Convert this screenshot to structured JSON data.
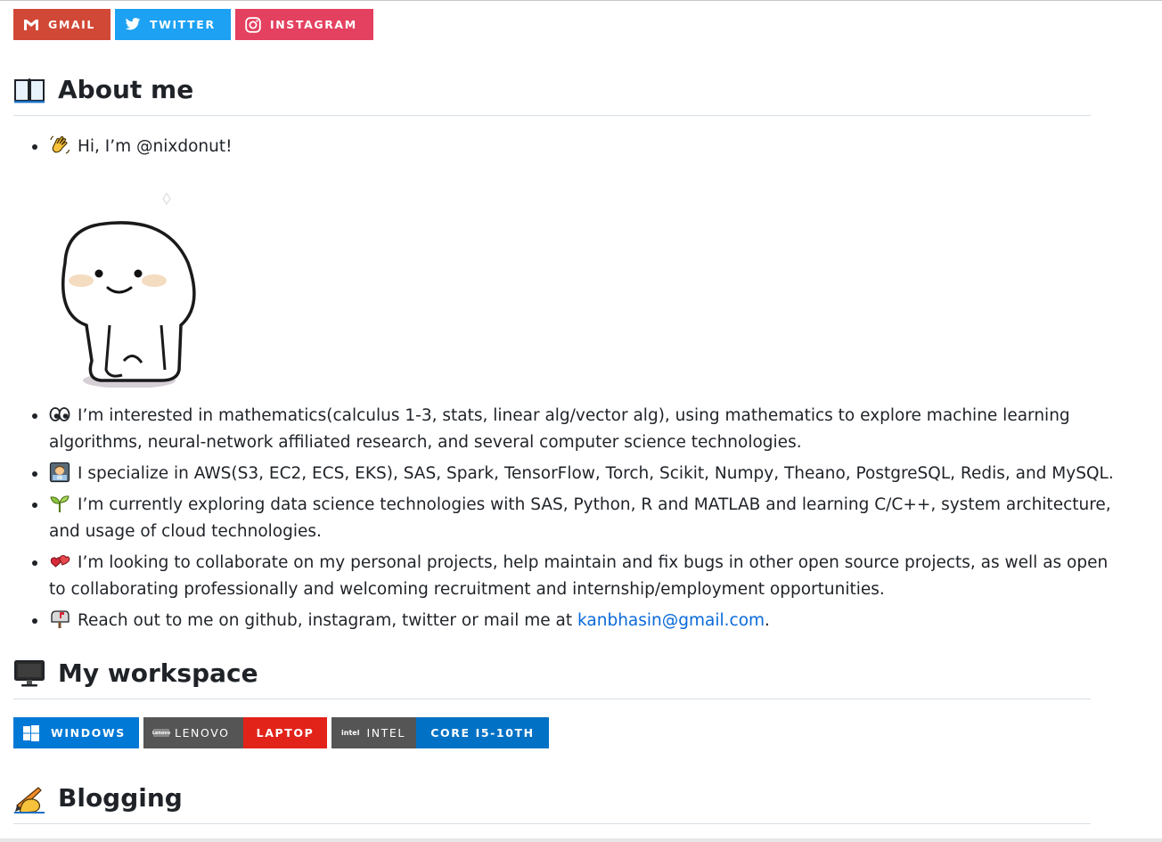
{
  "social_badges": [
    {
      "label": "GMAIL",
      "icon": "gmail-icon",
      "color": "#d14836"
    },
    {
      "label": "TWITTER",
      "icon": "twitter-icon",
      "color": "#1da1f2"
    },
    {
      "label": "INSTAGRAM",
      "icon": "instagram-icon",
      "color": "#e4405f"
    }
  ],
  "about": {
    "heading": "About me",
    "heading_icon": "open-book-icon",
    "greeting": "Hi, I’m @nixdonut!",
    "items": [
      {
        "icon": "eyes-icon",
        "text": "I’m interested in mathematics(calculus 1-3, stats, linear alg/vector alg), using mathematics to explore machine learning algorithms, neural-network affiliated research, and several computer science technologies."
      },
      {
        "icon": "technologist-icon",
        "text": "I specialize in AWS(S3, EC2, ECS, EKS), SAS, Spark, TensorFlow, Torch, Scikit, Numpy, Theano, PostgreSQL, Redis, and MySQL."
      },
      {
        "icon": "seedling-icon",
        "text": "I’m currently exploring data science technologies with SAS, Python, R and MATLAB and learning C/C++, system architecture, and usage of cloud technologies."
      },
      {
        "icon": "revolving-hearts-icon",
        "text": "I’m looking to collaborate on my personal projects, help maintain and fix bugs in other open source projects, as well as open to collaborating professionally and welcoming recruitment and internship/employment opportunities."
      }
    ],
    "contact_prefix": "Reach out to me on github, instagram, twitter or mail me at ",
    "contact_email": "kanbhasin@gmail.com",
    "contact_suffix": "."
  },
  "workspace": {
    "heading": "My workspace",
    "heading_icon": "desktop-computer-icon",
    "badges": {
      "windows": "WINDOWS",
      "lenovo_logo": "Lenovo",
      "lenovo": "LENOVO",
      "laptop": "LAPTOP",
      "intel_logo": "intel",
      "intel": "INTEL",
      "core": "CORE I5-10TH"
    },
    "colors": {
      "windows": "#0078d6",
      "laptop": "#e2231a",
      "core": "#0071c5",
      "label_gray": "#555555"
    }
  },
  "blogging": {
    "heading": "Blogging",
    "heading_icon": "writing-hand-icon"
  }
}
